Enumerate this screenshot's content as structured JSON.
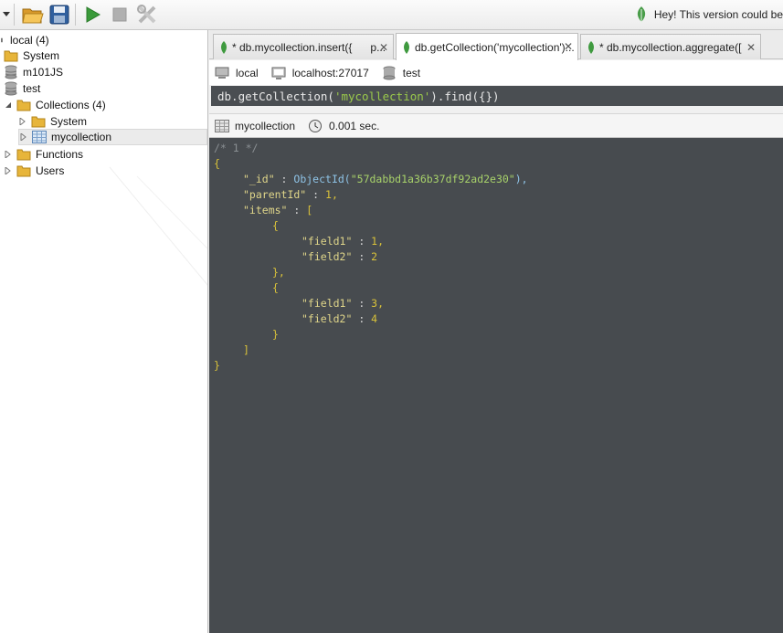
{
  "toolbar": {
    "notice": "Hey! This version could be"
  },
  "tree": {
    "root": "local (4)",
    "system": "System",
    "m101js": "m101JS",
    "test": "test",
    "collections": "Collections (4)",
    "coll_system": "System",
    "mycollection": "mycollection",
    "functions": "Functions",
    "users": "Users"
  },
  "tabs": [
    {
      "label": "* db.mycollection.insert({",
      "suffix": "p..."
    },
    {
      "label": "db.getCollection('mycollection')..."
    },
    {
      "label": "* db.mycollection.aggregate(["
    }
  ],
  "info": {
    "connection": "local",
    "server": "localhost:27017",
    "database": "test"
  },
  "query": {
    "prefix": "db.getCollection(",
    "arg": "'mycollection'",
    "suffix": ").find({})"
  },
  "results": {
    "collection": "mycollection",
    "time": "0.001 sec."
  },
  "document": {
    "comment": "/* 1 */",
    "id_key": "\"_id\"",
    "id_oid": "ObjectId(",
    "id_value": "\"57dabbd1a36b37df92ad2e30\"",
    "id_close": "),",
    "parent_key": "\"parentId\"",
    "parent_value": "1,",
    "items_key": "\"items\"",
    "items_open": "[",
    "item1_field1_key": "\"field1\"",
    "item1_field1_value": "1,",
    "item1_field2_key": "\"field2\"",
    "item1_field2_value": "2",
    "item2_field1_key": "\"field1\"",
    "item2_field1_value": "3,",
    "item2_field2_key": "\"field2\"",
    "item2_field2_value": "4",
    "items_close": "]",
    "open_brace": "{",
    "close_brace": "}",
    "obj_open": "{",
    "obj_close_comma": "},",
    "obj_close": "}",
    "sep": " : "
  },
  "colors": {
    "output_bg": "#474b4f",
    "brace": "#d9c23a",
    "string": "#a8d26a",
    "objectid": "#8ec3e6",
    "leaf_green": "#3f9a3f"
  }
}
